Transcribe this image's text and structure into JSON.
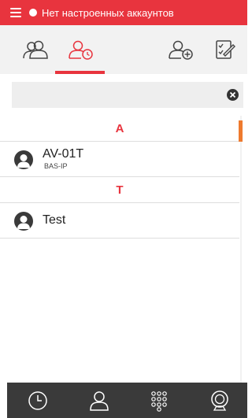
{
  "header": {
    "menu_icon": "hamburger-menu-icon",
    "status_text": "Нет настроенных аккаунтов",
    "accent_color": "#e8343e"
  },
  "tabs": [
    {
      "icon": "contacts-group-icon",
      "active": false
    },
    {
      "icon": "call-history-contact-icon",
      "active": true
    },
    {
      "icon": "add-contact-icon",
      "active": false
    },
    {
      "icon": "edit-list-icon",
      "active": false
    }
  ],
  "search": {
    "value": "",
    "placeholder": "",
    "clear_icon": "clear-icon"
  },
  "sections": [
    {
      "letter": "A",
      "contacts": [
        {
          "name": "AV-01T",
          "subtitle": "BAS-IP"
        }
      ]
    },
    {
      "letter": "T",
      "contacts": [
        {
          "name": "Test",
          "subtitle": ""
        }
      ]
    }
  ],
  "bottom_nav": [
    {
      "icon": "clock-icon"
    },
    {
      "icon": "contact-icon"
    },
    {
      "icon": "dialpad-icon"
    },
    {
      "icon": "camera-icon"
    }
  ],
  "scrollbar_color": "#ee7a2e"
}
